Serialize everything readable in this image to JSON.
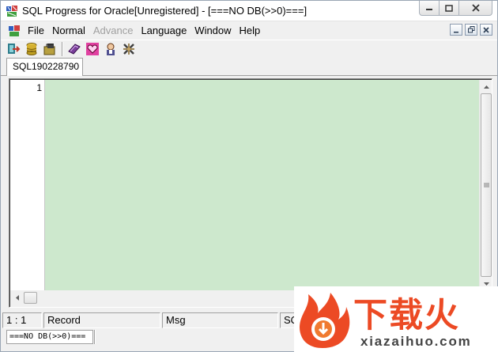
{
  "window": {
    "title": "SQL Progress for Oracle[Unregistered] - [===NO DB(>>0)===]"
  },
  "menu": {
    "items": [
      {
        "label": "File",
        "enabled": true
      },
      {
        "label": "Normal",
        "enabled": true
      },
      {
        "label": "Advance",
        "enabled": false
      },
      {
        "label": "Language",
        "enabled": true
      },
      {
        "label": "Window",
        "enabled": true
      },
      {
        "label": "Help",
        "enabled": true
      }
    ]
  },
  "toolbar": {
    "buttons": [
      "connect-icon",
      "database-icon",
      "open-icon",
      "book-icon",
      "heart-icon",
      "user-icon",
      "tools-icon"
    ]
  },
  "tabs": [
    {
      "label": "SQL190228790",
      "active": true
    }
  ],
  "editor": {
    "line_numbers": [
      "1"
    ],
    "content": "",
    "background": "#cde8cd"
  },
  "status": {
    "position": "1 : 1",
    "record": "Record",
    "msg": "Msg",
    "extra": "SQ",
    "db": "===NO DB(>>0)==="
  },
  "watermark": {
    "brand": "下载火",
    "domain": "xiazaihuo.com",
    "color": "#ec4a24"
  }
}
